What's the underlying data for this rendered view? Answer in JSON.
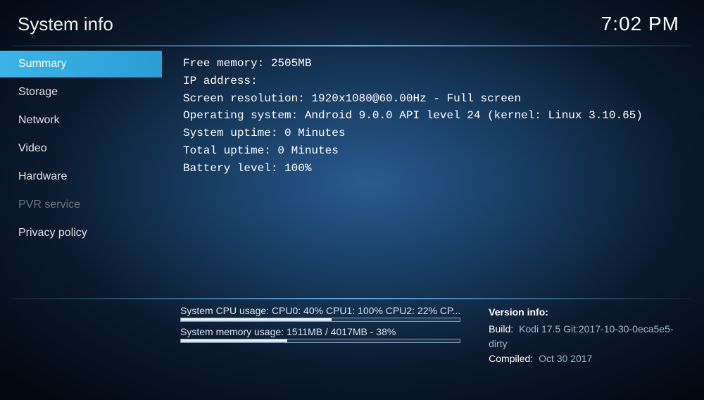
{
  "header": {
    "title": "System info",
    "clock": "7:02 PM"
  },
  "sidebar": {
    "items": [
      {
        "label": "Summary",
        "selected": true,
        "disabled": false
      },
      {
        "label": "Storage",
        "selected": false,
        "disabled": false
      },
      {
        "label": "Network",
        "selected": false,
        "disabled": false
      },
      {
        "label": "Video",
        "selected": false,
        "disabled": false
      },
      {
        "label": "Hardware",
        "selected": false,
        "disabled": false
      },
      {
        "label": "PVR service",
        "selected": false,
        "disabled": true
      },
      {
        "label": "Privacy policy",
        "selected": false,
        "disabled": false
      }
    ]
  },
  "summary": {
    "lines": [
      {
        "label": "Free memory: ",
        "value": "2505MB"
      },
      {
        "label": "IP address:",
        "value": ""
      },
      {
        "label": "Screen resolution: ",
        "value": "1920x1080@60.00Hz - Full screen"
      },
      {
        "label": "Operating system: ",
        "value": "Android 9.0.0 API level 24 (kernel: Linux 3.10.65)"
      },
      {
        "label": "System uptime: ",
        "value": "0 Minutes"
      },
      {
        "label": "Total uptime: ",
        "value": "0 Minutes"
      },
      {
        "label": "Battery level: ",
        "value": "100%"
      }
    ]
  },
  "footer": {
    "cpu": {
      "label": "System CPU usage: CPU0:  40% CPU1: 100% CPU2:  22% CP...",
      "percent": 54
    },
    "memory": {
      "label": "System memory usage: 1511MB / 4017MB - 38%",
      "percent": 38
    },
    "version": {
      "title": "Version info:",
      "build_label": "Build:",
      "build_value": "Kodi 17.5 Git:2017-10-30-0eca5e5-dirty",
      "compiled_label": "Compiled:",
      "compiled_value": "Oct 30 2017"
    }
  }
}
